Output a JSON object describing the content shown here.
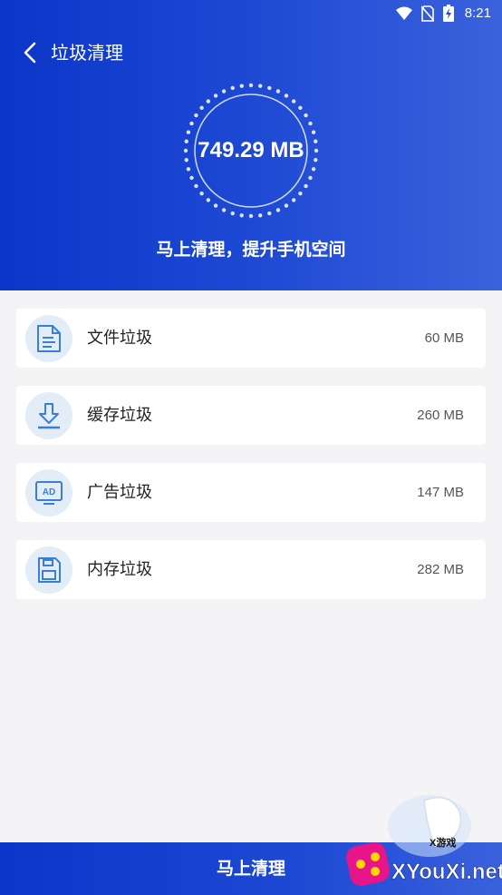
{
  "status_bar": {
    "time": "8:21",
    "icons": [
      "wifi-icon",
      "no-sim-icon",
      "battery-charging-icon"
    ]
  },
  "header": {
    "title": "垃圾清理",
    "back_icon": "chevron-left-icon"
  },
  "summary": {
    "total_size": "749.29 MB",
    "subtitle": "马上清理，提升手机空间"
  },
  "items": [
    {
      "label": "文件垃圾",
      "size": "60 MB",
      "icon": "document-icon"
    },
    {
      "label": "缓存垃圾",
      "size": "260 MB",
      "icon": "download-icon"
    },
    {
      "label": "广告垃圾",
      "size": "147 MB",
      "icon": "ad-icon"
    },
    {
      "label": "内存垃圾",
      "size": "282 MB",
      "icon": "memory-card-icon"
    }
  ],
  "action": {
    "clean_label": "马上清理"
  },
  "watermark": {
    "site": "XYouXi.net",
    "tag": "X游戏"
  },
  "colors": {
    "primary": "#1d49d4",
    "icon_blue": "#3a7fd5",
    "icon_bg": "#e3edf8"
  }
}
